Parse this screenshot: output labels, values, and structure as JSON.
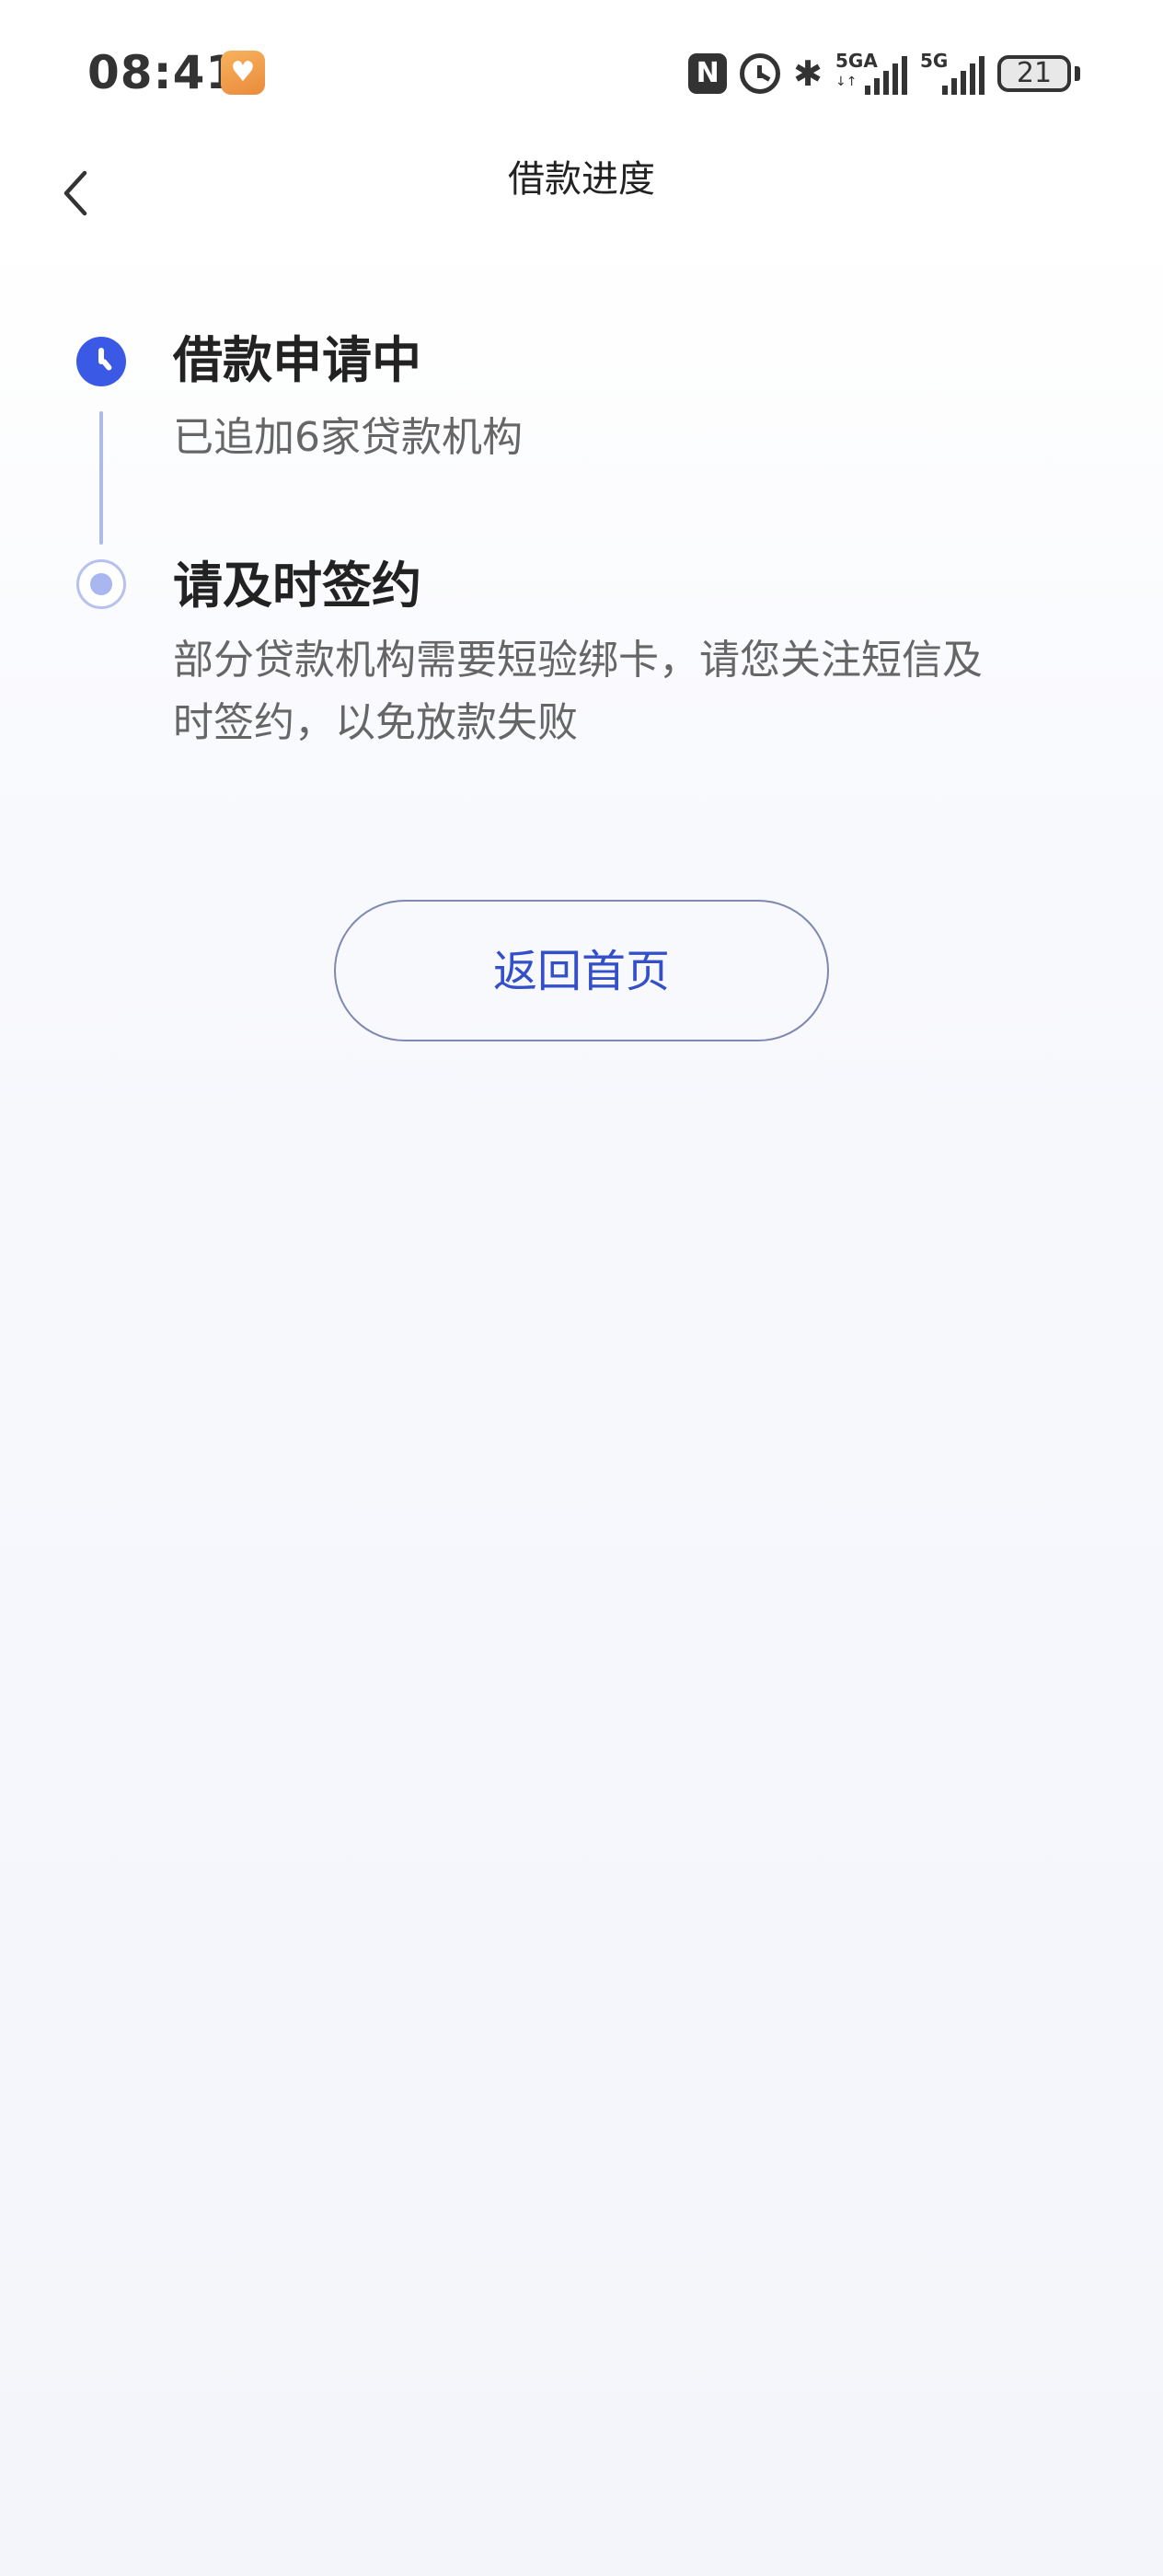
{
  "status_bar": {
    "time": "08:41",
    "nfc_label": "N",
    "signal_1_label": "5GA",
    "signal_1_sub": "↓↑",
    "signal_2_label": "5G",
    "battery_level": "21",
    "icons": [
      "health-app-icon",
      "nfc-icon",
      "alarm-icon",
      "bluetooth-icon",
      "signal-5ga-icon",
      "signal-5g-icon",
      "battery-icon"
    ]
  },
  "nav": {
    "title": "借款进度",
    "back_icon": "chevron-left-icon"
  },
  "steps": [
    {
      "title": "借款申请中",
      "description": "已追加6家贷款机构",
      "icon": "clock-icon",
      "state": "active"
    },
    {
      "title": "请及时签约",
      "description": "部分贷款机构需要短验绑卡，请您关注短信及时签约，以免放款失败",
      "icon": "dot-icon",
      "state": "pending"
    }
  ],
  "actions": {
    "home_button_label": "返回首页"
  },
  "colors": {
    "accent": "#3a5ae6",
    "button_text": "#3450c9",
    "pending_dot": "#a9b7f1",
    "connector": "#aebbe9"
  }
}
